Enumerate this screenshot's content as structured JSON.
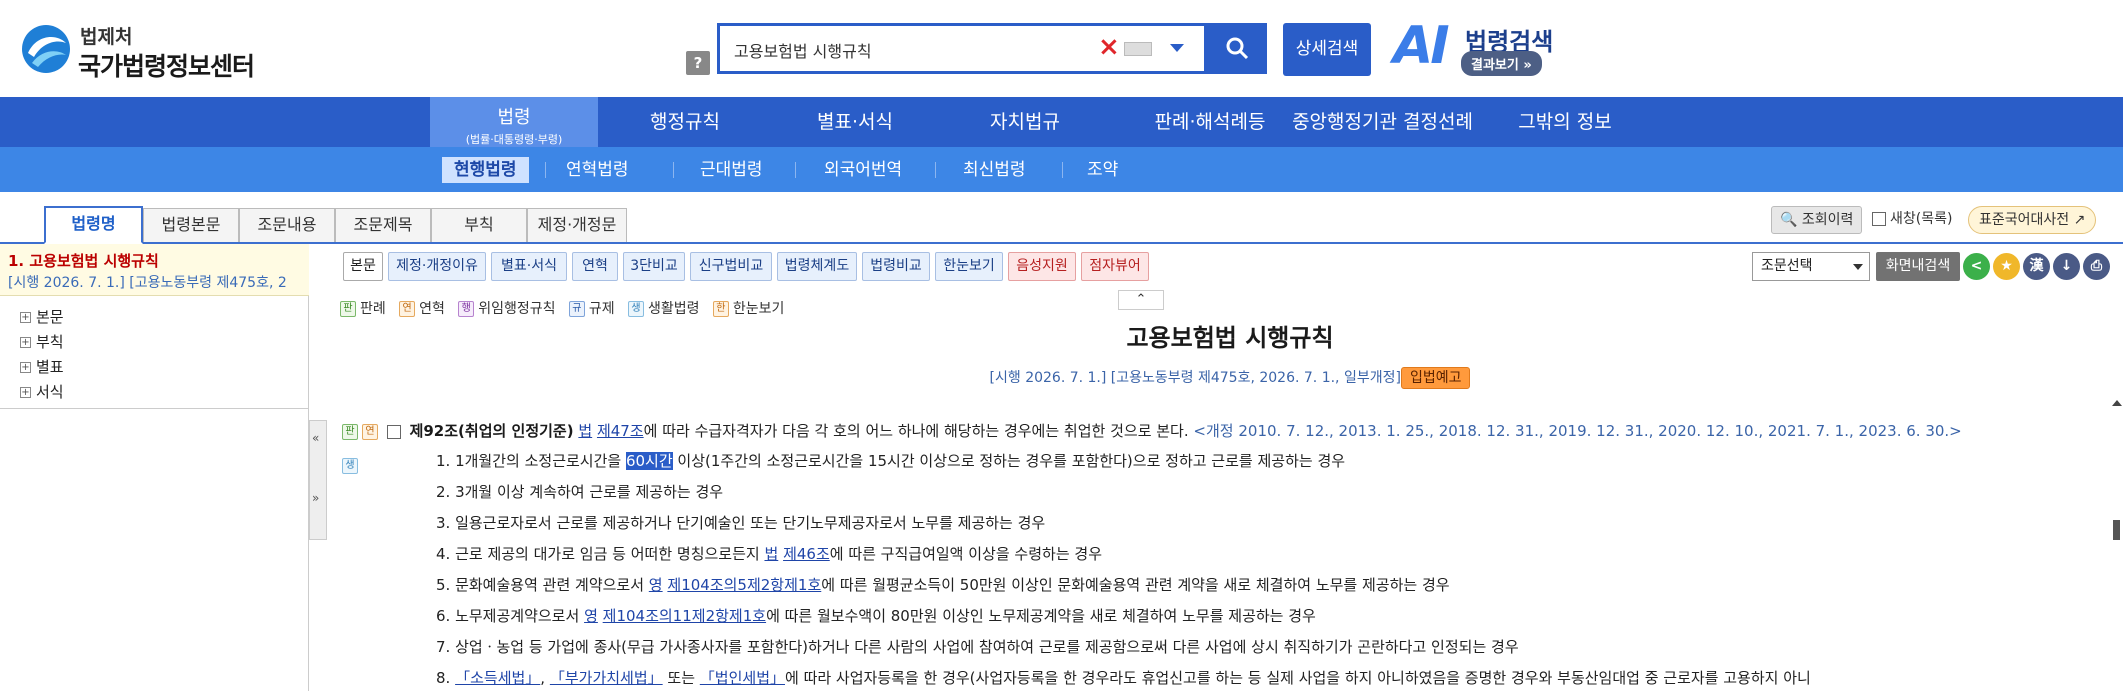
{
  "header": {
    "logo_small": "법제처",
    "logo_big": "국가법령정보센터",
    "help": "?",
    "search_value": "고용보험법 시행규칙",
    "detail_search": "상세검색",
    "ai_letters": "AI",
    "ai_title": "법령검색",
    "ai_result": "결과보기 »"
  },
  "nav1": [
    {
      "label": "법령",
      "sub": "(법률·대통령령·부령)"
    },
    {
      "label": "행정규칙"
    },
    {
      "label": "별표·서식"
    },
    {
      "label": "자치법규"
    },
    {
      "label": "판례·해석례등"
    },
    {
      "label": "중앙행정기관 결정선례"
    },
    {
      "label": "그밖의 정보"
    }
  ],
  "nav2": [
    "현행법령",
    "연혁법령",
    "근대법령",
    "외국어번역",
    "최신법령",
    "조약"
  ],
  "tabs": [
    "법령명",
    "법령본문",
    "조문내용",
    "조문제목",
    "부칙",
    "제정·개정문"
  ],
  "tools": {
    "history": "조회이력",
    "new_window": "새창(목록)",
    "dictionary": "표준국어대사전"
  },
  "left": {
    "title": "1. 고용보험법 시행규칙",
    "sub": "[시행 2026. 7. 1.] [고용노동부령 제475호, 2",
    "tree": [
      "본문",
      "부칙",
      "별표",
      "서식"
    ]
  },
  "toolbar": [
    "본문",
    "제정·개정이유",
    "별표·서식",
    "연혁",
    "3단비교",
    "신구법비교",
    "법령체계도",
    "법령비교",
    "한눈보기",
    "음성지원",
    "점자뷰어"
  ],
  "select_label": "조문선택",
  "screen_search": "화면내검색",
  "icons": {
    "share": "<",
    "star": "★",
    "hanja": "漢",
    "download": "↓",
    "print": "⎙"
  },
  "legend": [
    {
      "badge": "판",
      "text": "판례"
    },
    {
      "badge": "연",
      "text": "연혁"
    },
    {
      "badge": "행",
      "text": "위임행정규칙"
    },
    {
      "badge": "규",
      "text": "규제"
    },
    {
      "badge": "생",
      "text": "생활법령"
    },
    {
      "badge": "한",
      "text": "한눈보기"
    }
  ],
  "doc": {
    "title": "고용보험법 시행규칙",
    "sub": "[시행 2026. 7. 1.] [고용노동부령 제475호, 2026. 7. 1., 일부개정]",
    "ipbeop": "입법예고",
    "article_title": "제92조(취업의 인정기준)",
    "article_ref_law": "법",
    "article_ref_art": "제47조",
    "article_rest": "에 따라 수급자격자가 다음 각 호의 어느 하나에 해당하는 경우에는 취업한 것으로 본다.",
    "article_amend": "<개정 2010. 7. 12., 2013. 1. 25., 2018. 12. 31., 2019. 12. 31., 2020. 12. 10., 2021. 7. 1., 2023. 6. 30.>",
    "items": {
      "i1a": "1. 1개월간의 소정근로시간을 ",
      "i1h": "60시간",
      "i1b": " 이상(1주간의 소정근로시간을 15시간 이상으로 정하는 경우를 포함한다)으로 정하고 근로를 제공하는 경우",
      "i2": "2. 3개월 이상 계속하여 근로를 제공하는 경우",
      "i3": "3. 일용근로자로서 근로를 제공하거나 단기예술인 또는 단기노무제공자로서 노무를 제공하는 경우",
      "i4a": "4. 근로 제공의 대가로 임금 등 어떠한 명칭으로든지 ",
      "i4l": "법",
      "i4r": "제46조",
      "i4b": "에 따른 구직급여일액 이상을 수령하는 경우",
      "i5a": "5. 문화예술용역 관련 계약으로서 ",
      "i5l": "영",
      "i5r": "제104조의5제2항제1호",
      "i5b": "에 따른 월평균소득이 50만원 이상인 문화예술용역 관련 계약을 새로 체결하여 노무를 제공하는 경우",
      "i6a": "6. 노무제공계약으로서 ",
      "i6l": "영",
      "i6r": "제104조의11제2항제1호",
      "i6b": "에 따른 월보수액이 80만원 이상인 노무제공계약을 새로 체결하여 노무를 제공하는 경우",
      "i7": "7. 상업ㆍ농업 등 가업에 종사(무급 가사종사자를 포함한다)하거나 다른 사람의 사업에 참여하여 근로를 제공함으로써 다른 사업에 상시 취직하기가 곤란하다고 인정되는 경우",
      "i8a": "8. ",
      "i8q1": "「소득세법」",
      "i8c1": ", ",
      "i8q2": "「부가가치세법」",
      "i8c2": " 또는 ",
      "i8q3": "「법인세법」",
      "i8b": "에 따라 사업자등록을 한 경우(사업자등록을 한 경우라도 휴업신고를 하는 등 실제 사업을 하지 아니하였음을 증명한 경우와 부동산임대업 중 근로자를 고용하지 아니"
    }
  }
}
